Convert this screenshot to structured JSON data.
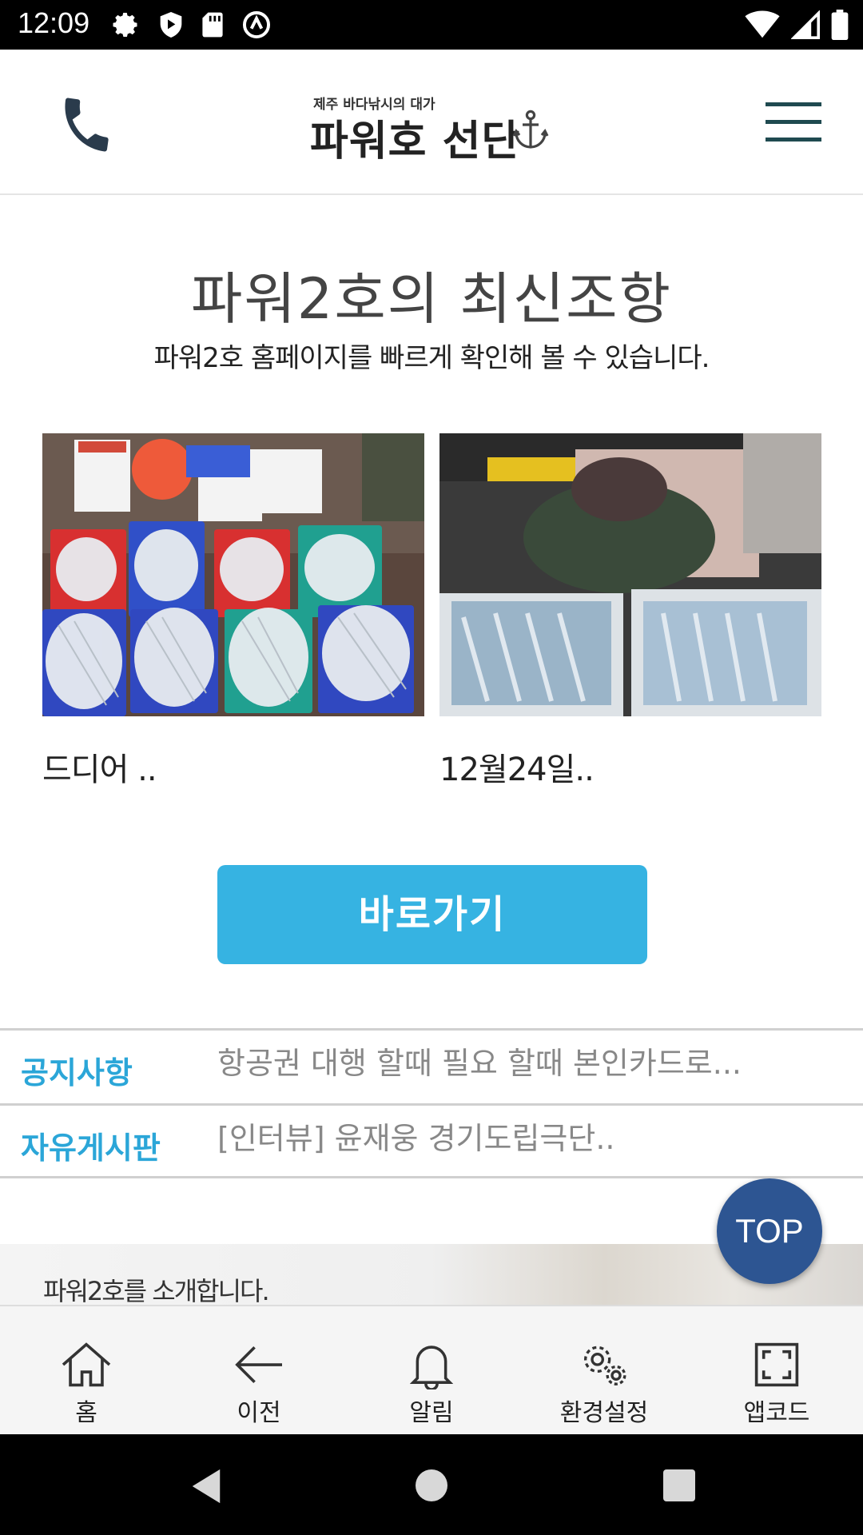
{
  "status_bar": {
    "time": "12:09"
  },
  "header": {
    "logo_sub": "제주 바다낚시의 대가",
    "logo_main": "파워호 선단"
  },
  "section": {
    "title": "파워2호의 최신조항",
    "subtitle": "파워2호 홈페이지를 빠르게 확인해 볼 수 있습니다."
  },
  "cards": [
    {
      "caption": "드디어 .."
    },
    {
      "caption": "12월24일.."
    }
  ],
  "go_button": "바로가기",
  "board": [
    {
      "category": "공지사항",
      "text": "항공권 대행 할때 필요 할때 본인카드로..."
    },
    {
      "category": "자유게시판",
      "text": "[인터뷰] 윤재웅 경기도립극단.."
    }
  ],
  "top_button": "TOP",
  "intro": "파워2호를 소개합니다.",
  "bottom_nav": [
    {
      "label": "홈",
      "icon": "home-icon"
    },
    {
      "label": "이전",
      "icon": "back-arrow-icon"
    },
    {
      "label": "알림",
      "icon": "bell-icon"
    },
    {
      "label": "환경설정",
      "icon": "gear-icon"
    },
    {
      "label": "앱코드",
      "icon": "qr-frame-icon"
    }
  ],
  "colors": {
    "accent_blue": "#36b3e2",
    "category_blue": "#2ba6d8",
    "top_button": "#2d5592",
    "menu_icon": "#1f4a50"
  }
}
